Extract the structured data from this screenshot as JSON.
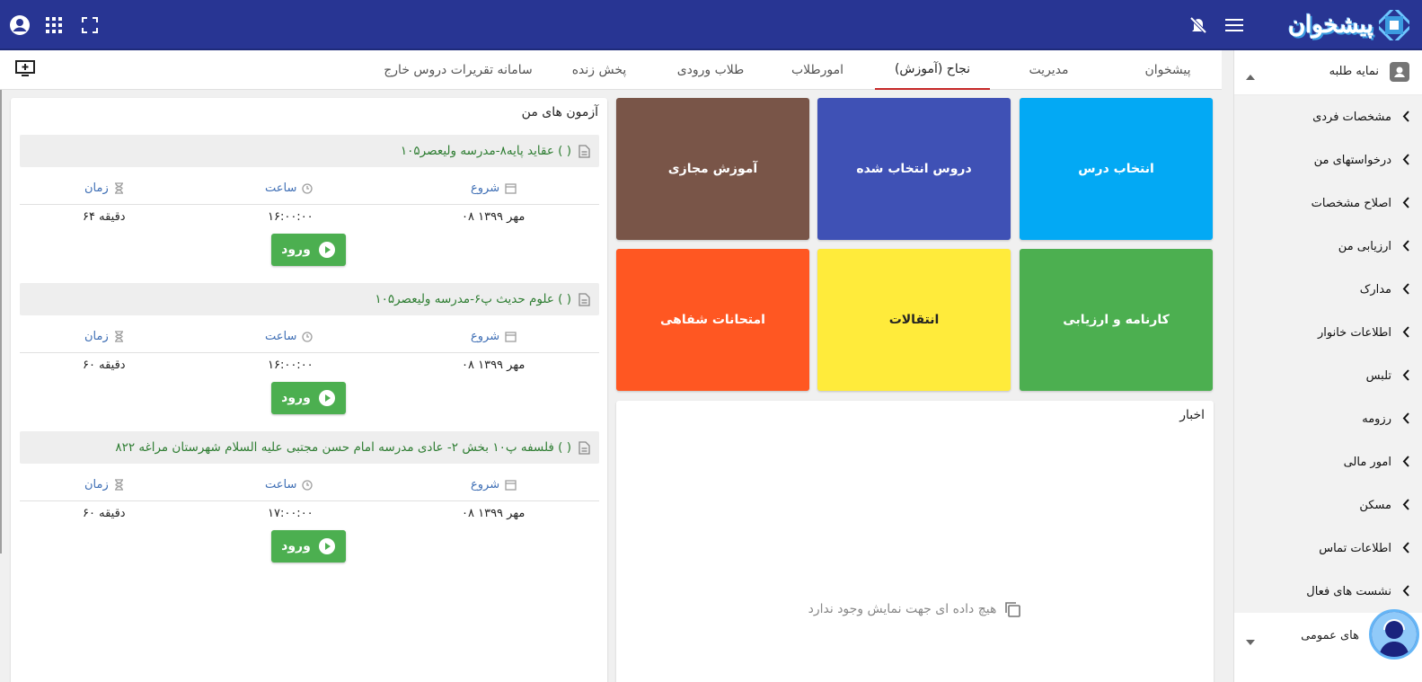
{
  "app": {
    "logo_text": "پیشخوان"
  },
  "topbar": {
    "icons": [
      "account-icon",
      "apps-grid-icon",
      "fullscreen-icon",
      "notifications-off-icon",
      "menu-icon"
    ]
  },
  "tabs": [
    {
      "label": "پیشخوان",
      "active": false
    },
    {
      "label": "مدیریت",
      "active": false
    },
    {
      "label": "نجاح (آموزش)",
      "active": true
    },
    {
      "label": "امورطلاب",
      "active": false
    },
    {
      "label": "طلاب ورودی",
      "active": false
    },
    {
      "label": "پخش زنده",
      "active": false
    },
    {
      "label": "سامانه تقریرات دروس خارج",
      "active": false
    }
  ],
  "sidebar": {
    "header": "نمایه طلبه",
    "items": [
      {
        "label": "مشخصات فردی"
      },
      {
        "label": "درخواستهای من"
      },
      {
        "label": "اصلاح مشخصات"
      },
      {
        "label": "ارزیابی من"
      },
      {
        "label": "مدارک"
      },
      {
        "label": "اطلاعات خانوار"
      },
      {
        "label": "تلبس"
      },
      {
        "label": "رزومه"
      },
      {
        "label": "امور مالی"
      },
      {
        "label": "مسکن"
      },
      {
        "label": "اطلاعات تماس"
      },
      {
        "label": "نشست های فعال"
      }
    ],
    "footer": "های عمومی"
  },
  "tiles": [
    {
      "label": "انتخاب درس",
      "color": "#03a9f4"
    },
    {
      "label": "دروس انتخاب شده",
      "color": "#3f51b5"
    },
    {
      "label": "آموزش مجازی",
      "color": "#795548"
    },
    {
      "label": "کارنامه و ارزیابی",
      "color": "#4caf50"
    },
    {
      "label": "انتقالات",
      "color": "#ffeb3b"
    },
    {
      "label": "امتحانات شفاهی",
      "color": "#ff5722"
    }
  ],
  "news": {
    "title": "اخبار",
    "empty_message": "هیچ داده ای جهت نمایش وجود ندارد"
  },
  "exams": {
    "title": "آزمون های من",
    "col_start": "شروع",
    "col_time": "ساعت",
    "col_duration": "زمان",
    "enter_label": "ورود",
    "items": [
      {
        "title": "عقاید پایه۸-مدرسه ولیعصر۱۰۵ ( )",
        "start": "۰۸ مهر ۱۳۹۹",
        "time": "۱۶:۰۰:۰۰",
        "duration": "۶۴ دقیقه"
      },
      {
        "title": "علوم حدیث پ۶-مدرسه ولیعصر۱۰۵ ( )",
        "start": "۰۸ مهر ۱۳۹۹",
        "time": "۱۶:۰۰:۰۰",
        "duration": "۶۰ دقیقه"
      },
      {
        "title": "فلسفه پ۱۰ بخش ۲- عادی مدرسه امام حسن مجتبی علیه السلام شهرستان مراغه ۸۲۲ ( )",
        "start": "۰۸ مهر ۱۳۹۹",
        "time": "۱۷:۰۰:۰۰",
        "duration": "۶۰ دقیقه"
      }
    ]
  }
}
